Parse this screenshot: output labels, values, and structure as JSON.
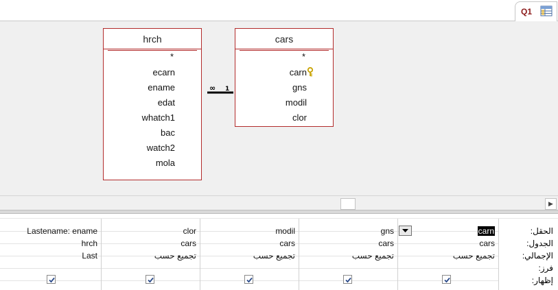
{
  "tab": {
    "label": "Q1",
    "icon": "query-table-icon"
  },
  "tables": [
    {
      "name": "hrch",
      "fields": [
        "*",
        "ecarn",
        "ename",
        "edat",
        "whatch1",
        "bac",
        "watch2",
        "mola"
      ]
    },
    {
      "name": "cars",
      "fields": [
        "*",
        "carn",
        "gns",
        "modil",
        "clor"
      ],
      "primary_key": "carn"
    }
  ],
  "relationship": {
    "left": "∞",
    "right": "1"
  },
  "grid": {
    "row_labels": {
      "field": "الحقل:",
      "table": "الجدول:",
      "total": "الإجمالي:",
      "sort": "فرز:",
      "show": "إظهار:"
    },
    "columns": [
      {
        "field": "carn",
        "table": "cars",
        "total": "تجميع حسب",
        "show": true,
        "selected": true
      },
      {
        "field": "gns",
        "table": "cars",
        "total": "تجميع حسب",
        "show": true,
        "has_dropdown": true
      },
      {
        "field": "modil",
        "table": "cars",
        "total": "تجميع حسب",
        "show": true
      },
      {
        "field": "clor",
        "table": "cars",
        "total": "تجميع حسب",
        "show": true
      },
      {
        "field": "Lastename: ename",
        "table": "hrch",
        "total": "Last",
        "show": true
      }
    ]
  },
  "colors": {
    "table_border": "#b22a2a",
    "tab_text": "#8b1a1a",
    "design_bg": "#f0f0f0"
  }
}
